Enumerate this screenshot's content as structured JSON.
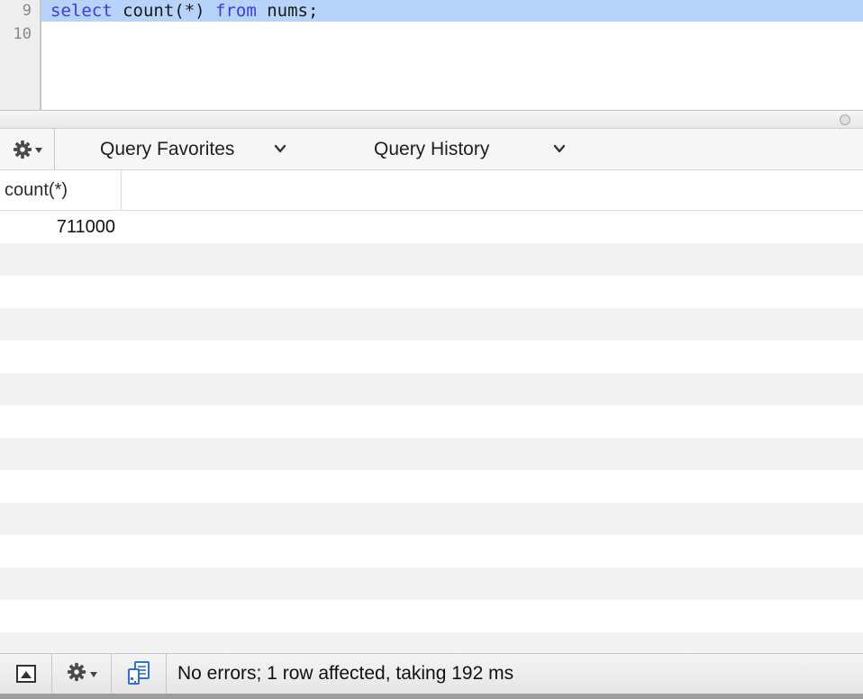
{
  "editor": {
    "lines": [
      {
        "number": "9",
        "tokens": [
          {
            "text": "select",
            "kind": "keyword"
          },
          {
            "text": " count(*) ",
            "kind": "plain"
          },
          {
            "text": "from",
            "kind": "keyword"
          },
          {
            "text": " nums;",
            "kind": "plain"
          }
        ],
        "selected": true
      },
      {
        "number": "10",
        "tokens": [],
        "selected": false
      }
    ],
    "selection_color": "#b7d3fa",
    "keyword_color": "#3b3bea"
  },
  "query_toolbar": {
    "gear_icon": "gear-icon",
    "favorites_label": "Query Favorites",
    "history_label": "Query History"
  },
  "results": {
    "columns": [
      "count(*)"
    ],
    "rows": [
      [
        "711000"
      ]
    ],
    "stripe_color": "#f3f3f3"
  },
  "status_bar": {
    "toggle_icon": "toggle-panel-icon",
    "gear_icon": "gear-icon",
    "console_icon": "query-console-icon",
    "message": "No errors; 1 row affected, taking 192 ms"
  }
}
